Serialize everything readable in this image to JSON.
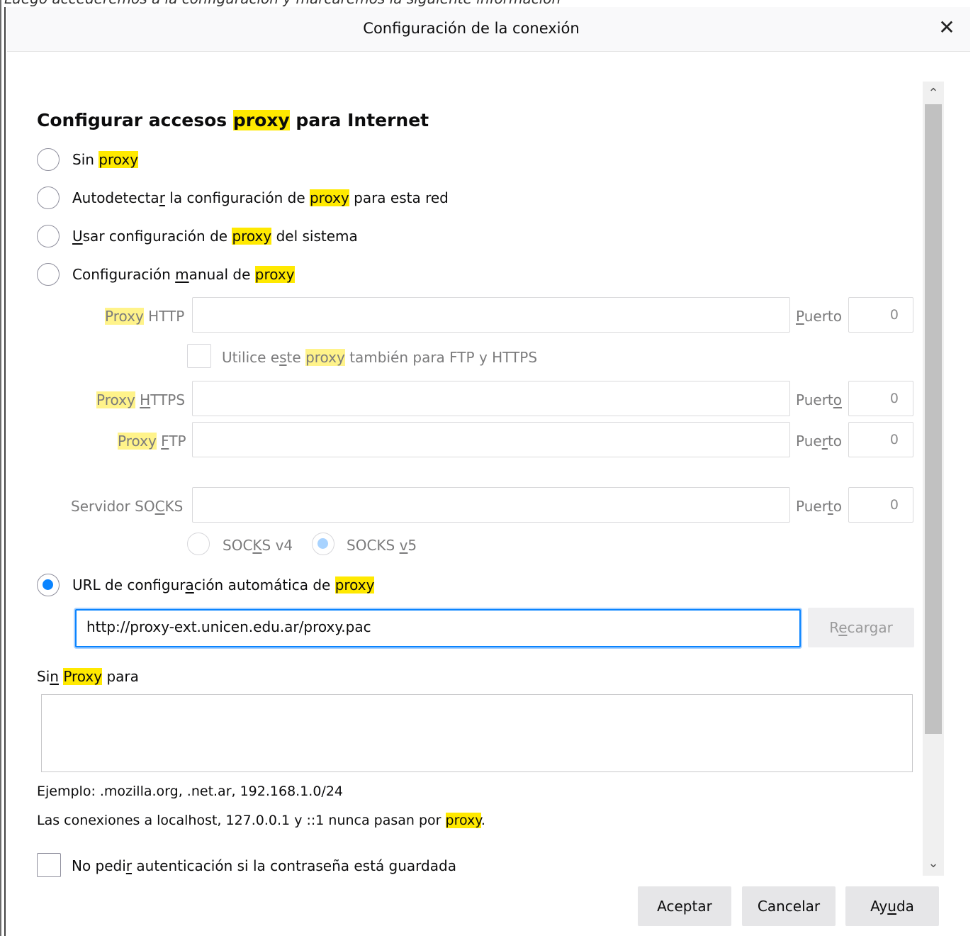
{
  "top_fragment": "Luego accederemos a la configuración y marcaremos la siguiente información",
  "dialog": {
    "title": "Configuración de la conexión",
    "close_glyph": "✕"
  },
  "section_title": {
    "before": "Configurar accesos ",
    "highlight": "proxy",
    "after": " para Internet"
  },
  "options": {
    "sin_proxy": {
      "before": "Sin ",
      "highlight": "proxy"
    },
    "autodetect": {
      "a": "Autodetecta",
      "u": "r",
      "b": " la configuración de ",
      "highlight": "proxy",
      "c": " para esta red"
    },
    "sistema": {
      "u": "U",
      "a": "sar configuración de ",
      "highlight": "proxy",
      "b": " del sistema"
    },
    "manual": {
      "a": "Configuración ",
      "u": "m",
      "b": "anual de ",
      "highlight": "proxy"
    },
    "auto_url": {
      "a": "URL de configur",
      "u": "a",
      "b": "ción automática de ",
      "highlight": "proxy"
    }
  },
  "manual": {
    "http": {
      "highlight": "Proxy",
      "after": " HTTP",
      "port_label": {
        "u": "P",
        "rest": "uerto"
      },
      "port_value": "0"
    },
    "share_checkbox": {
      "a": "Utilice e",
      "u": "s",
      "b": "te ",
      "highlight": "proxy",
      "c": " también para FTP y HTTPS"
    },
    "https": {
      "highlight": "Proxy",
      "space": " ",
      "u": "H",
      "after": "TTPS",
      "port_label": {
        "a": "Puert",
        "u": "o"
      },
      "port_value": "0"
    },
    "ftp": {
      "highlight": "Proxy",
      "space": " ",
      "u": "F",
      "after": "TP",
      "port_label": {
        "a": "Pue",
        "u": "r",
        "b": "to"
      },
      "port_value": "0"
    },
    "socks": {
      "a": "Servidor SO",
      "u": "C",
      "b": "KS",
      "port_label": {
        "a": "Puer",
        "u": "t",
        "b": "o"
      },
      "port_value": "0"
    },
    "socks_v4": {
      "a": "SOC",
      "u": "K",
      "b": "S v4"
    },
    "socks_v5": {
      "a": "SOCKS ",
      "u": "v",
      "b": "5"
    }
  },
  "auto_url_value": "http://proxy-ext.unicen.edu.ar/proxy.pac",
  "reload_button": {
    "a": "R",
    "u": "e",
    "b": "cargar"
  },
  "no_proxy": {
    "a": "Si",
    "u": "n",
    "b": " ",
    "highlight": "Proxy",
    "c": " para"
  },
  "example_text": "Ejemplo: .mozilla.org, .net.ar, 192.168.1.0/24",
  "localhost_note": {
    "before": "Las conexiones a localhost, 127.0.0.1 y ::1 nunca pasan por ",
    "highlight": "proxy",
    "after": "."
  },
  "auth_checkbox": {
    "a": "No pedi",
    "u": "r",
    "b": " autenticación si la contraseña está guardada"
  },
  "buttons": {
    "accept": "Aceptar",
    "cancel": "Cancelar",
    "help": {
      "a": "Ay",
      "u": "u",
      "b": "da"
    }
  },
  "scroll_up_glyph": "⌃",
  "scroll_down_glyph": "⌄",
  "colors": {
    "accent": "#0a84ff",
    "highlight": "#ffe900"
  }
}
